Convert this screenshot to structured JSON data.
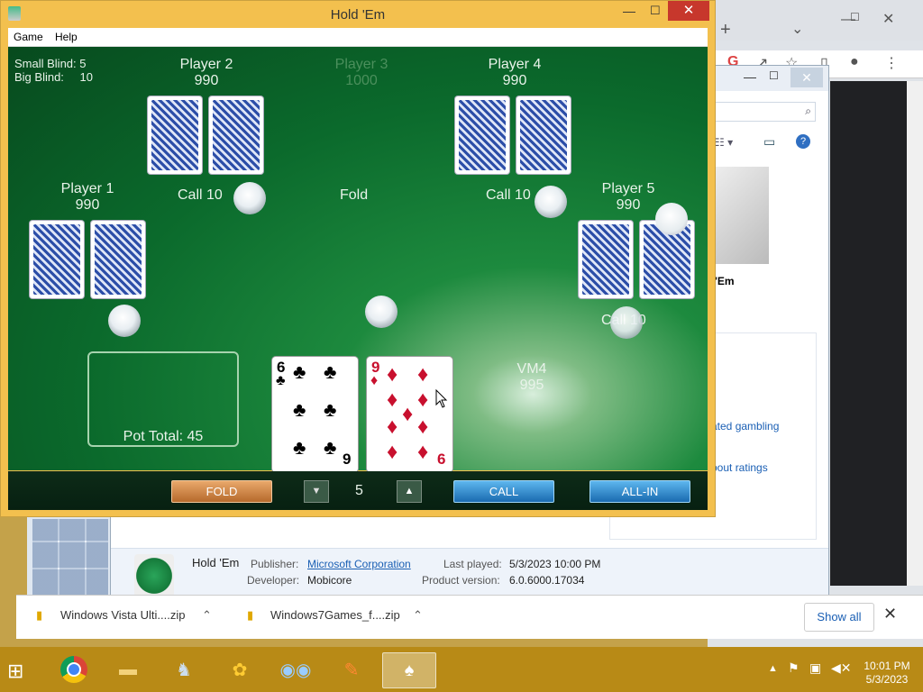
{
  "chrome": {
    "new_tab": "+",
    "dropdown": "⌄"
  },
  "explorer": {
    "sidebar_links": [
      "ated gambling",
      "bout ratings"
    ],
    "game_caption": "'Em",
    "details": {
      "name": "Hold 'Em",
      "publisher_label": "Publisher:",
      "publisher": "Microsoft Corporation",
      "developer_label": "Developer:",
      "developer": "Mobicore",
      "last_played_label": "Last played:",
      "last_played": "5/3/2023 10:00 PM",
      "product_version_label": "Product version:",
      "product_version": "6.0.6000.17034"
    }
  },
  "downloads": {
    "items": [
      "Windows Vista Ulti....zip",
      "Windows7Games_f....zip"
    ],
    "show_all": "Show all"
  },
  "holdem": {
    "window_title": "Hold 'Em",
    "menu": [
      "Game",
      "Help"
    ],
    "blinds": {
      "small_label": "Small Blind:",
      "small_value": "5",
      "big_label": "Big Blind:",
      "big_value": "10"
    },
    "players": [
      {
        "name": "Player 1",
        "chips": "990"
      },
      {
        "name": "Player 2",
        "chips": "990"
      },
      {
        "name": "Player 3",
        "chips": "1000"
      },
      {
        "name": "Player 4",
        "chips": "990"
      },
      {
        "name": "Player 5",
        "chips": "990"
      }
    ],
    "actions": {
      "p2": "Call 10",
      "p3": "Fold",
      "p4": "Call 10",
      "p5": "Call 10"
    },
    "hero": {
      "name": "VM4",
      "chips": "995"
    },
    "pot_total": "Pot Total: 45",
    "hero_cards": [
      {
        "rank": "6",
        "suit": "♣",
        "color": "#000000"
      },
      {
        "rank": "9",
        "suit": "♦",
        "color": "#c8102e"
      }
    ],
    "controls": {
      "fold": "FOLD",
      "bet_amount": "5",
      "call": "CALL",
      "all_in": "ALL-IN"
    }
  },
  "taskbar": {
    "time": "10:01 PM",
    "date": "5/3/2023"
  }
}
